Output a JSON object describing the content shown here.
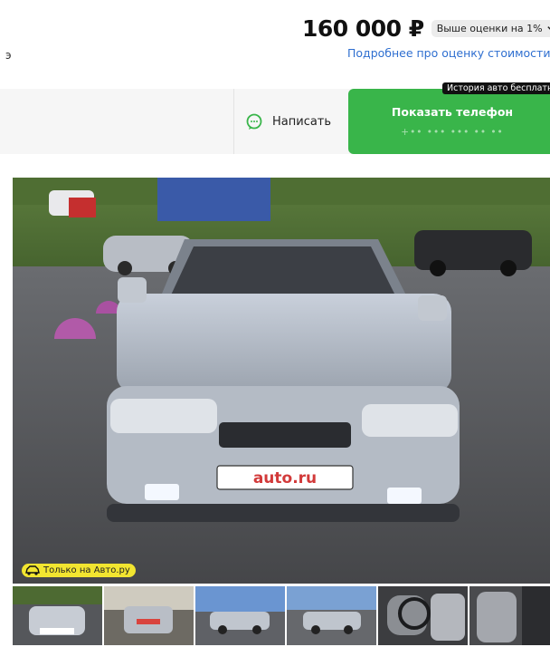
{
  "header": {
    "price": "160 000 ₽",
    "evaluation_badge": "Выше оценки на 1%",
    "about_link": "Подробнее про оценку стоимости",
    "clipped_char": "э"
  },
  "contact": {
    "write_label": "Написать",
    "phone_label": "Показать телефон",
    "phone_masked": "+•• ••• ••• •• ••",
    "history_tag": "История авто бесплатно"
  },
  "gallery": {
    "plate_text": "auto.ru",
    "only_badge": "Только на Авто.ру",
    "thumbnail_count": 6
  },
  "colors": {
    "accent_green": "#39b54a",
    "link_blue": "#2f6fd0",
    "badge_yellow": "#f2e530"
  },
  "icons": {
    "chevron": "chevron-down-icon",
    "chat": "chat-bubble-icon",
    "car": "car-icon"
  }
}
